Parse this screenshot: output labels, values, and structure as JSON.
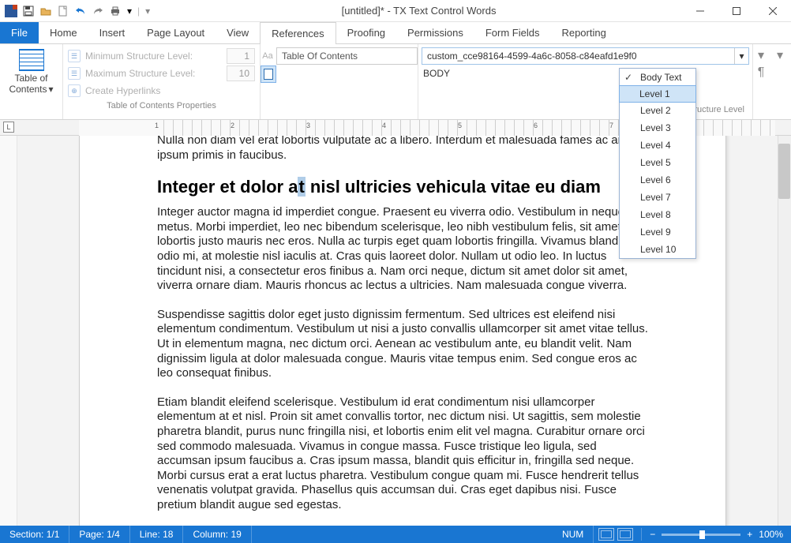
{
  "window": {
    "title": "[untitled]* - TX Text Control Words"
  },
  "tabs": {
    "file": "File",
    "home": "Home",
    "insert": "Insert",
    "page_layout": "Page Layout",
    "view": "View",
    "references": "References",
    "proofing": "Proofing",
    "permissions": "Permissions",
    "form_fields": "Form Fields",
    "reporting": "Reporting"
  },
  "ribbon": {
    "toc_label_l1": "Table of",
    "toc_label_l2": "Contents",
    "min_level_label": "Minimum Structure Level:",
    "min_level_value": "1",
    "max_level_label": "Maximum Structure Level:",
    "max_level_value": "10",
    "create_hyperlinks": "Create Hyperlinks",
    "group_toc_props": "Table of Contents Properties",
    "title_value": "Table Of Contents",
    "style_selected": "custom_cce98164-4599-4a6c-8058-c84eafd1e9f0",
    "body_label": "BODY",
    "group_para_level": "Paragraph Structure Level"
  },
  "level_options": [
    {
      "label": "Body Text",
      "checked": true,
      "highlight": false
    },
    {
      "label": "Level 1",
      "checked": false,
      "highlight": true
    },
    {
      "label": "Level 2",
      "checked": false,
      "highlight": false
    },
    {
      "label": "Level 3",
      "checked": false,
      "highlight": false
    },
    {
      "label": "Level 4",
      "checked": false,
      "highlight": false
    },
    {
      "label": "Level 5",
      "checked": false,
      "highlight": false
    },
    {
      "label": "Level 6",
      "checked": false,
      "highlight": false
    },
    {
      "label": "Level 7",
      "checked": false,
      "highlight": false
    },
    {
      "label": "Level 8",
      "checked": false,
      "highlight": false
    },
    {
      "label": "Level 9",
      "checked": false,
      "highlight": false
    },
    {
      "label": "Level 10",
      "checked": false,
      "highlight": false
    }
  ],
  "ruler_label": "L",
  "document": {
    "p1": "Nulla non diam vel erat lobortis vulputate ac a libero. Interdum et malesuada fames ac ante ipsum primis in faucibus.",
    "h2_pre": "Integer et dolor a",
    "h2_cur": "t",
    "h2_post": " nisl ultricies vehicula vitae eu diam",
    "p2": "Integer auctor magna id imperdiet congue. Praesent eu viverra odio. Vestibulum in neque metus. Morbi imperdiet, leo nec bibendum scelerisque, leo nibh vestibulum felis, sit amet lobortis justo mauris nec eros. Nulla ac turpis eget quam lobortis fringilla. Vivamus blandit odio mi, at molestie nisl iaculis at. Cras quis laoreet dolor. Nullam ut odio leo. In luctus tincidunt nisi, a consectetur eros finibus a. Nam orci neque, dictum sit amet dolor sit amet, viverra ornare diam. Mauris rhoncus ac lectus a ultricies. Nam malesuada congue viverra.",
    "p3": "Suspendisse sagittis dolor eget justo dignissim fermentum. Sed ultrices est eleifend nisi elementum condimentum. Vestibulum ut nisi a justo convallis ullamcorper sit amet vitae tellus. Ut in elementum magna, nec dictum orci. Aenean ac vestibulum ante, eu blandit velit. Nam dignissim ligula at dolor malesuada congue. Mauris vitae tempus enim. Sed congue eros ac leo consequat finibus.",
    "p4": "Etiam blandit eleifend scelerisque. Vestibulum id erat condimentum nisi ullamcorper elementum at et nisl. Proin sit amet convallis tortor, nec dictum nisi. Ut sagittis, sem molestie pharetra blandit, purus nunc fringilla nisi, et lobortis enim elit vel magna. Curabitur ornare orci sed commodo malesuada. Vivamus in congue massa. Fusce tristique leo ligula, sed accumsan ipsum faucibus a. Cras ipsum massa, blandit quis efficitur in, fringilla sed neque. Morbi cursus erat a erat luctus pharetra. Vestibulum congue quam mi. Fusce hendrerit tellus venenatis volutpat gravida. Phasellus quis accumsan dui. Cras eget dapibus nisi. Fusce pretium blandit augue sed egestas."
  },
  "status": {
    "section": "Section: 1/1",
    "page": "Page: 1/4",
    "line": "Line: 18",
    "column": "Column: 19",
    "num": "NUM",
    "zoom": "100%"
  }
}
